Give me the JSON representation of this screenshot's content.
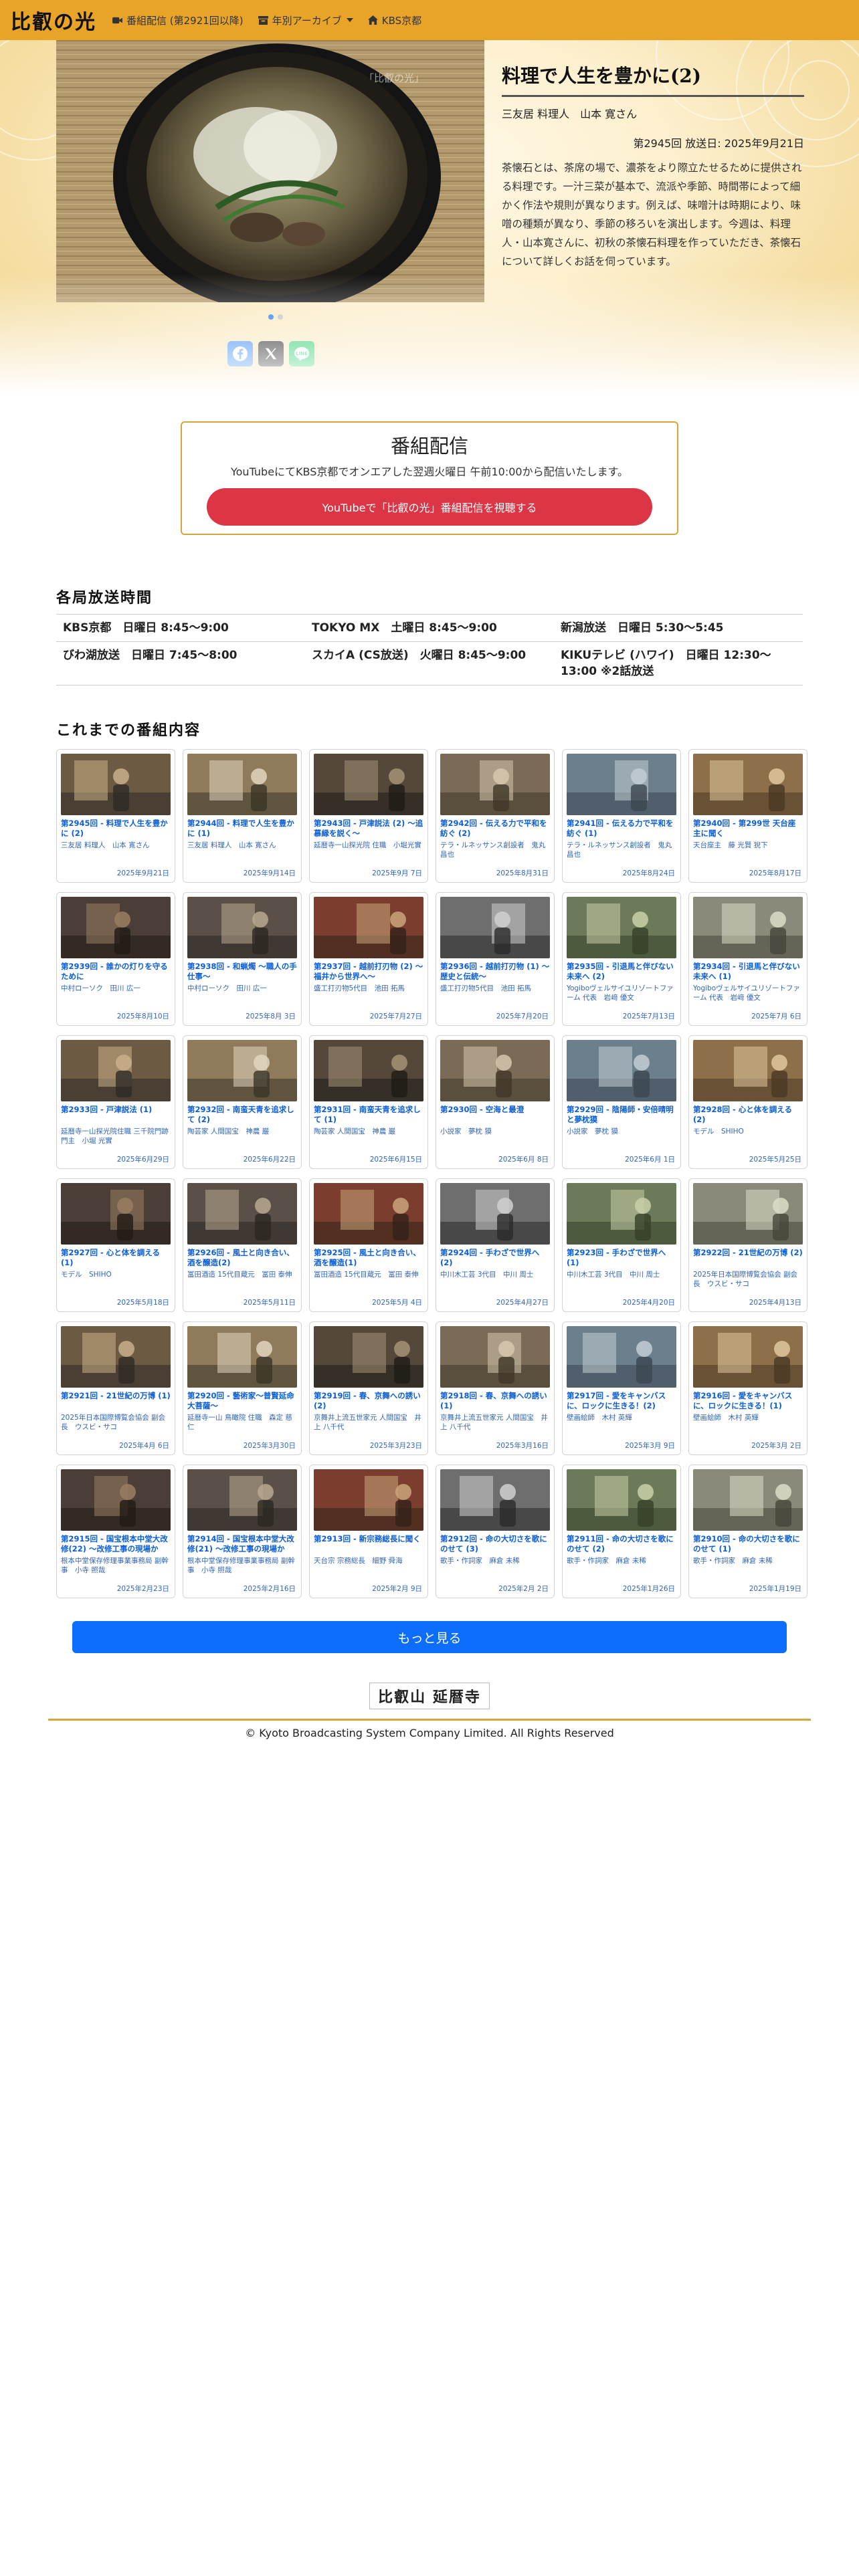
{
  "nav": {
    "brand": "比叡の光",
    "items": [
      {
        "label": "番組配信 (第2921回以降)",
        "icon": "video-icon"
      },
      {
        "label": "年別アーカイブ",
        "icon": "archive-icon",
        "has_caret": true
      },
      {
        "label": "KBS京都",
        "icon": "home-icon"
      }
    ]
  },
  "hero": {
    "title": "料理で人生を豊かに(2)",
    "guest": "三友居 料理人　山本 寛さん",
    "episode_date": "第2945回 放送日: 2025年9月21日",
    "description": "茶懐石とは、茶席の場で、濃茶をより際立たせるために提供される料理です。一汁三菜が基本で、流派や季節、時間帯によって細かく作法や規則が異なります。例えば、味噌汁は時期により、味噌の種類が異なり、季節の移ろいを演出します。今週は、料理人・山本寛さんに、初秋の茶懐石料理を作っていただき、茶懐石について詳しくお話を伺っています。",
    "photo_watermark": "「比叡の光」",
    "slides": 2,
    "active_slide": 0
  },
  "broadcast": {
    "title": "番組配信",
    "subtitle": "YouTubeにてKBS京都でオンエアした翌週火曜日 午前10:00から配信いたします。",
    "button_label": "YouTubeで「比叡の光」番組配信を視聴する"
  },
  "schedule": {
    "title": "各局放送時間",
    "rows": [
      [
        "KBS京都　日曜日 8:45～9:00",
        "TOKYO MX　土曜日 8:45～9:00",
        "新潟放送　日曜日 5:30～5:45"
      ],
      [
        "びわ湖放送　日曜日 7:45～8:00",
        "スカイA (CS放送)　火曜日 8:45～9:00",
        "KIKUテレビ (ハワイ)　日曜日 12:30～13:00 ※2話放送"
      ]
    ]
  },
  "episodes_title": "これまでの番組内容",
  "episodes": [
    {
      "title": "第2945回 - 料理で人生を豊かに (2)",
      "guest": "三友居 料理人　山本 寛さん",
      "date": "2025年9月21日"
    },
    {
      "title": "第2944回 - 料理で人生を豊かに (1)",
      "guest": "三友居 料理人　山本 寛さん",
      "date": "2025年9月14日"
    },
    {
      "title": "第2943回 - 戸津説法 (2) 〜追慕縁を説く〜",
      "guest": "延暦寺一山探光院 住職　小堀光實",
      "date": "2025年9月 7日"
    },
    {
      "title": "第2942回 - 伝える力で平和を紡ぐ (2)",
      "guest": "テラ・ルネッサンス創設者　鬼丸 昌也",
      "date": "2025年8月31日"
    },
    {
      "title": "第2941回 - 伝える力で平和を紡ぐ (1)",
      "guest": "テラ・ルネッサンス創設者　鬼丸 昌也",
      "date": "2025年8月24日"
    },
    {
      "title": "第2940回 - 第299世 天台座主に聞く",
      "guest": "天台座主　藤 光賢 猊下",
      "date": "2025年8月17日"
    },
    {
      "title": "第2939回 - 誰かの灯りを守るために",
      "guest": "中村ローソク　田川 広一",
      "date": "2025年8月10日"
    },
    {
      "title": "第2938回 - 和蝋燭 〜職人の手仕事〜",
      "guest": "中村ローソク　田川 広一",
      "date": "2025年8月 3日"
    },
    {
      "title": "第2937回 - 越前打刃物 (2) 〜福井から世界へ〜",
      "guest": "盛工打刃物5代目　池田 拓馬",
      "date": "2025年7月27日"
    },
    {
      "title": "第2936回 - 越前打刃物 (1) 〜歴史と伝統〜",
      "guest": "盛工打刃物5代目　池田 拓馬",
      "date": "2025年7月20日"
    },
    {
      "title": "第2935回 - 引退馬と伴びない未来へ (2)",
      "guest": "Yogiboヴェルサイユリゾートファーム 代表　岩﨑 優文",
      "date": "2025年7月13日"
    },
    {
      "title": "第2934回 - 引退馬と伴びない未来へ (1)",
      "guest": "Yogiboヴェルサイユリゾートファーム 代表　岩﨑 優文",
      "date": "2025年7月 6日"
    },
    {
      "title": "第2933回 - 戸津説法 (1)",
      "guest": "延暦寺一山探光院住職 三千院門跡門主　小堀 光實",
      "date": "2025年6月29日"
    },
    {
      "title": "第2932回 - 南蛮天青を追求して (2)",
      "guest": "陶芸家 人間国宝　神農 巌",
      "date": "2025年6月22日"
    },
    {
      "title": "第2931回 - 南蛮天青を追求して (1)",
      "guest": "陶芸家 人間国宝　神農 巌",
      "date": "2025年6月15日"
    },
    {
      "title": "第2930回 - 空海と最澄",
      "guest": "小説家　夢枕 獏",
      "date": "2025年6月 8日"
    },
    {
      "title": "第2929回 - 陰陽師・安倍晴明と夢枕獏",
      "guest": "小説家　夢枕 獏",
      "date": "2025年6月 1日"
    },
    {
      "title": "第2928回 - 心と体を調える (2)",
      "guest": "モデル　SHIHO",
      "date": "2025年5月25日"
    },
    {
      "title": "第2927回 - 心と体を調える (1)",
      "guest": "モデル　SHIHO",
      "date": "2025年5月18日"
    },
    {
      "title": "第2926回 - 風土と向き合い、酒を醸造(2)",
      "guest": "冨田酒造 15代目蔵元　冨田 泰伸",
      "date": "2025年5月11日"
    },
    {
      "title": "第2925回 - 風土と向き合い、酒を醸造(1)",
      "guest": "冨田酒造 15代目蔵元　冨田 泰伸",
      "date": "2025年5月 4日"
    },
    {
      "title": "第2924回 - 手わざで世界へ(2)",
      "guest": "中川木工芸 3代目　中川 周士",
      "date": "2025年4月27日"
    },
    {
      "title": "第2923回 - 手わざで世界へ(1)",
      "guest": "中川木工芸 3代目　中川 周士",
      "date": "2025年4月20日"
    },
    {
      "title": "第2922回 - 21世紀の万博 (2)",
      "guest": "2025年日本国際博覧会協会 副会長　ウスビ・サコ",
      "date": "2025年4月13日"
    },
    {
      "title": "第2921回 - 21世紀の万博 (1)",
      "guest": "2025年日本国際博覧会協会 副会長　ウスビ・サコ",
      "date": "2025年4月 6日"
    },
    {
      "title": "第2920回 - 藝術家〜普賢延命大菩薩〜",
      "guest": "延暦寺一山 鳥瞰院 住職　森定 慈仁",
      "date": "2025年3月30日"
    },
    {
      "title": "第2919回 - 春、京舞への誘い(2)",
      "guest": "京舞井上流五世家元 人間国宝　井上 八千代",
      "date": "2025年3月23日"
    },
    {
      "title": "第2918回 - 春、京舞への誘い(1)",
      "guest": "京舞井上流五世家元 人間国宝　井上 八千代",
      "date": "2025年3月16日"
    },
    {
      "title": "第2917回 - 愛をキャンバスに、ロックに生きる！(2)",
      "guest": "壁画絵師　木村 英輝",
      "date": "2025年3月 9日"
    },
    {
      "title": "第2916回 - 愛をキャンバスに、ロックに生きる！(1)",
      "guest": "壁画絵師　木村 英輝",
      "date": "2025年3月 2日"
    },
    {
      "title": "第2915回 - 国宝根本中堂大改修(22) 〜改修工事の現場から〜",
      "guest": "根本中堂保存修理事業事務局 副幹事　小寺 照哉",
      "date": "2025年2月23日"
    },
    {
      "title": "第2914回 - 国宝根本中堂大改修(21) 〜改修工事の現場から〜",
      "guest": "根本中堂保存修理事業事務局 副幹事　小寺 照哉",
      "date": "2025年2月16日"
    },
    {
      "title": "第2913回 - 新宗務総長に聞く",
      "guest": "天台宗 宗務総長　細野 舜海",
      "date": "2025年2月 9日"
    },
    {
      "title": "第2912回 - 命の大切さを歌にのせて (3)",
      "guest": "歌手・作詞家　麻倉 未稀",
      "date": "2025年2月 2日"
    },
    {
      "title": "第2911回 - 命の大切さを歌にのせて (2)",
      "guest": "歌手・作詞家　麻倉 未稀",
      "date": "2025年1月26日"
    },
    {
      "title": "第2910回 - 命の大切さを歌にのせて (1)",
      "guest": "歌手・作詞家　麻倉 未稀",
      "date": "2025年1月19日"
    }
  ],
  "more_button": "もっと見る",
  "sponsor_logo": "比叡山 延暦寺",
  "copyright": "© Kyoto Broadcasting System Company Limited. All Rights Reserved",
  "colors": {
    "navbar": "#e7a428",
    "accent_red": "#dc3545",
    "accent_blue": "#0d6efd",
    "gold_border": "#d6a53c"
  }
}
